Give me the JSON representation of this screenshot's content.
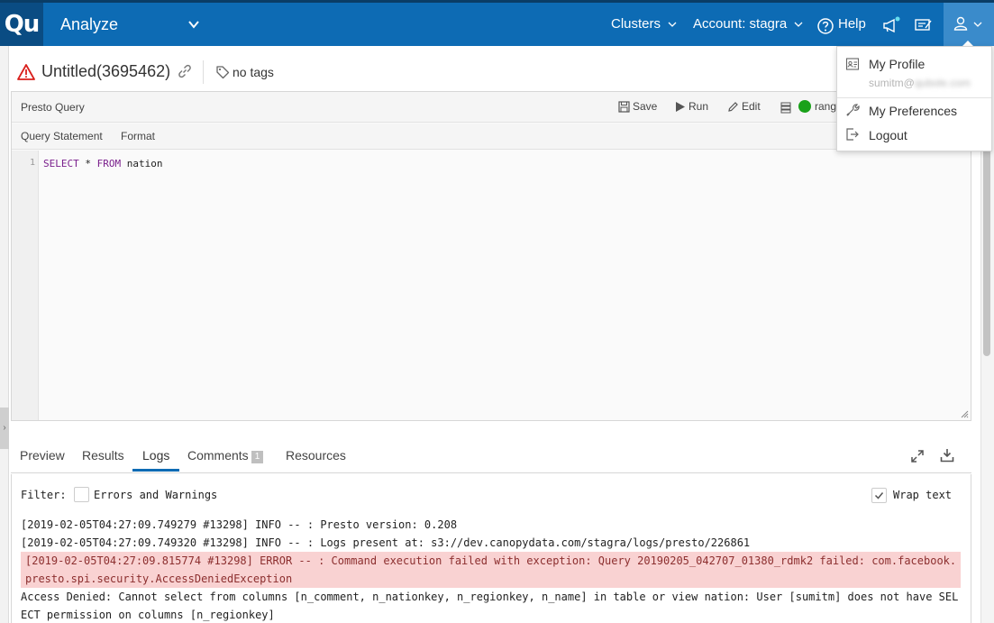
{
  "topbar": {
    "logo": "Qu",
    "app_name": "Analyze",
    "clusters": "Clusters",
    "account": "Account: stagra",
    "help": "Help",
    "bg_color": "#0d6bb4"
  },
  "query": {
    "title": "Untitled(3695462)",
    "tags": "no tags"
  },
  "editor": {
    "panel_title": "Presto Query",
    "save": "Save",
    "run": "Run",
    "edit": "Edit",
    "cluster": "rang",
    "tabs": [
      "Query Statement",
      "Format"
    ],
    "line_number": "1",
    "code": {
      "kw1": "SELECT",
      "op": " * ",
      "kw2": "FROM",
      "rest": " nation"
    }
  },
  "results": {
    "tabs": [
      "Preview",
      "Results",
      "Logs",
      "Comments",
      "Resources"
    ],
    "comments_count": "1",
    "active_tab": "Logs"
  },
  "logs": {
    "filter_label": "Filter:",
    "errors_warnings": "Errors and Warnings",
    "wrap_text": "Wrap text",
    "lines": [
      "[2019-02-05T04:27:09.749279 #13298] INFO -- : Presto version: 0.208",
      "[2019-02-05T04:27:09.749320 #13298] INFO -- : Logs present at: s3://dev.canopydata.com/stagra/logs/presto/226861",
      "[2019-02-05T04:27:09.815774 #13298] ERROR -- : Command execution failed with exception: Query 20190205_042707_01380_rdmk2 failed: com.facebook.presto.spi.security.AccessDeniedException",
      "Access Denied: Cannot select from columns [n_comment, n_nationkey, n_regionkey, n_name] in table or view nation: User [sumitm] does not have SELECT permission on columns [n_regionkey]"
    ]
  },
  "user_menu": {
    "my_profile": "My Profile",
    "email_user": "sumitm@",
    "email_domain": "qubole.com",
    "my_preferences": "My Preferences",
    "logout": "Logout"
  }
}
